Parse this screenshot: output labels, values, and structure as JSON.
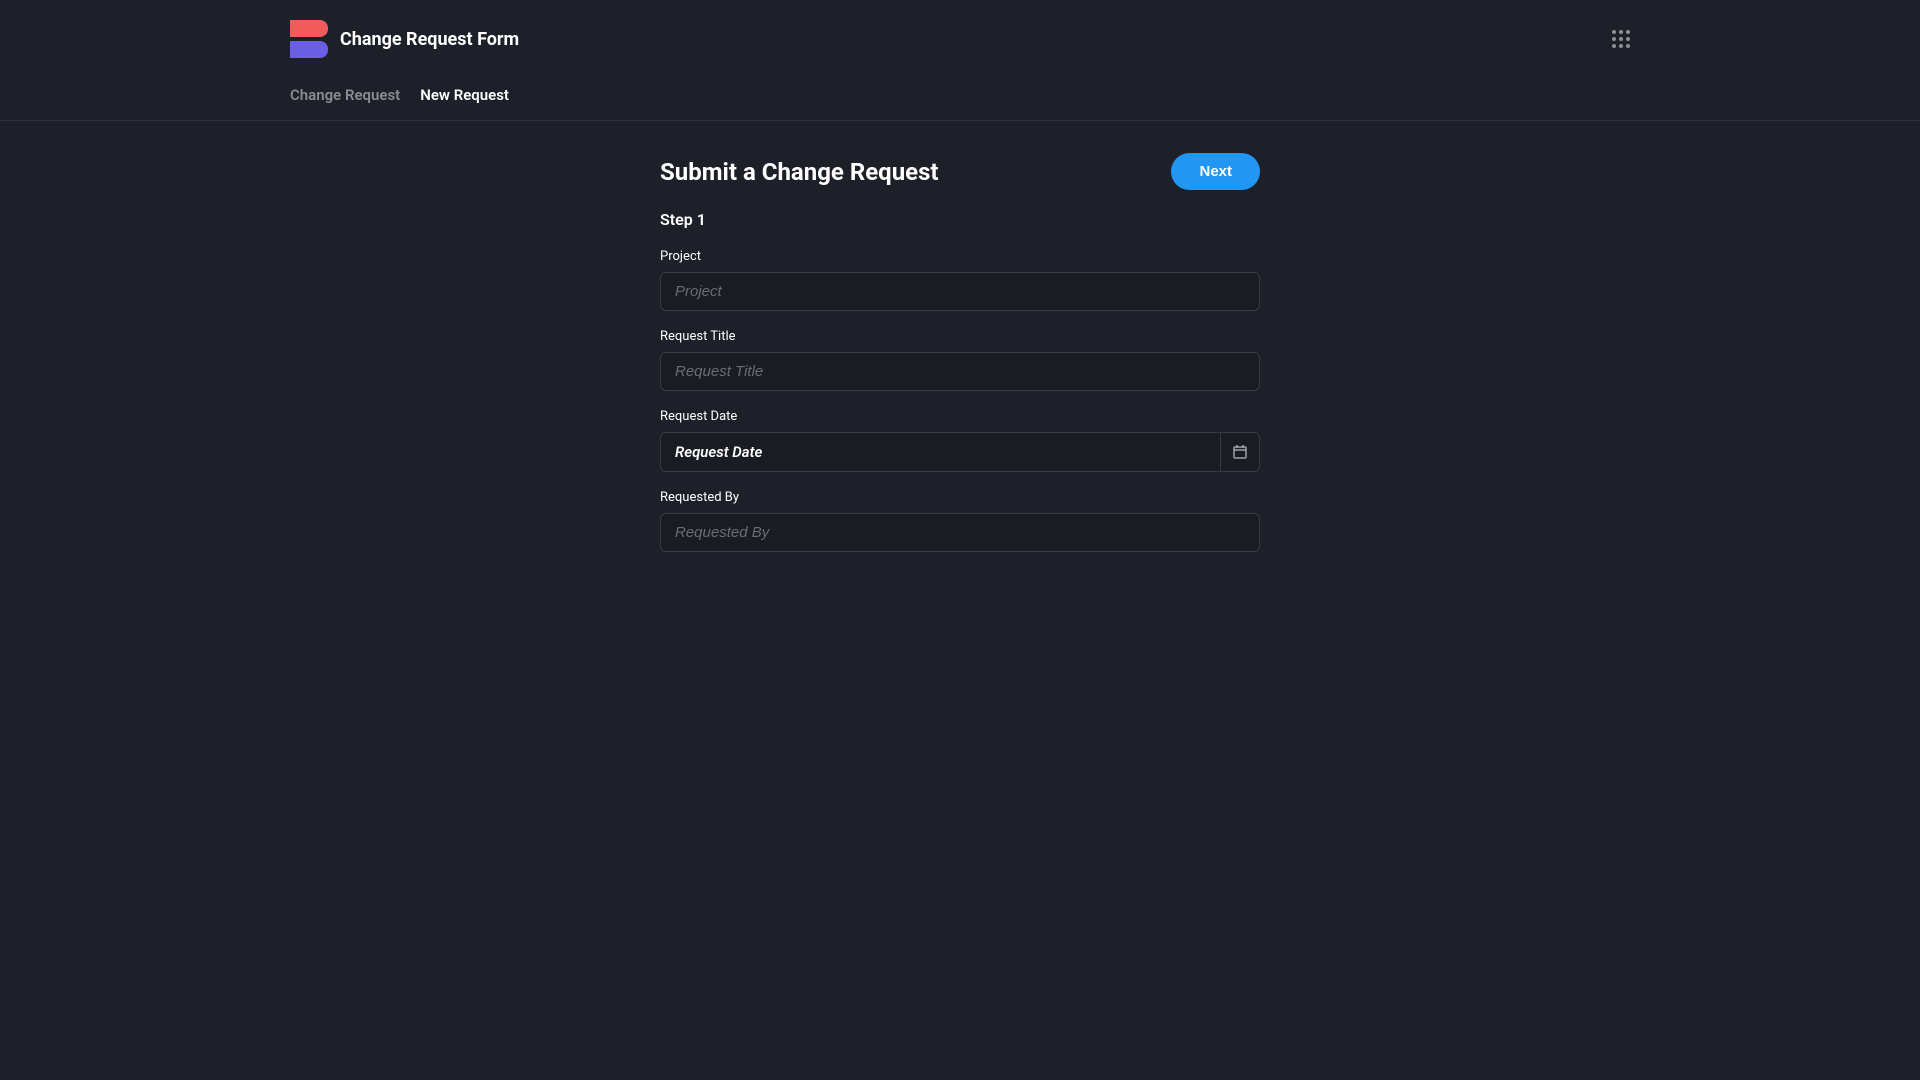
{
  "header": {
    "appTitle": "Change Request Form"
  },
  "nav": {
    "tabs": [
      {
        "label": "Change Request",
        "active": false
      },
      {
        "label": "New Request",
        "active": true
      }
    ]
  },
  "form": {
    "title": "Submit a Change Request",
    "nextButton": "Next",
    "stepLabel": "Step 1",
    "fields": {
      "project": {
        "label": "Project",
        "placeholder": "Project",
        "value": ""
      },
      "requestTitle": {
        "label": "Request Title",
        "placeholder": "Request Title",
        "value": ""
      },
      "requestDate": {
        "label": "Request Date",
        "placeholder": "Request Date",
        "value": "Request Date"
      },
      "requestedBy": {
        "label": "Requested By",
        "placeholder": "Requested By",
        "value": ""
      }
    }
  }
}
